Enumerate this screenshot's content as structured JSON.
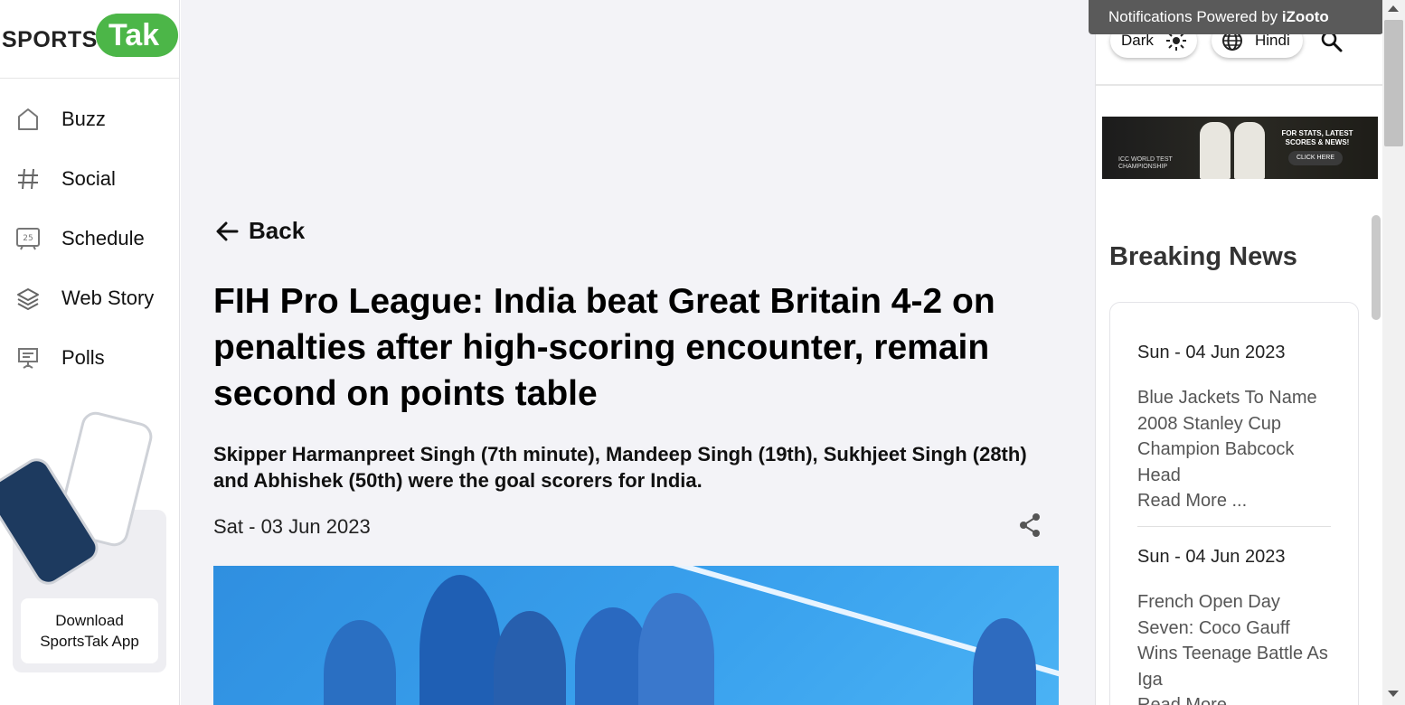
{
  "logo": {
    "sports": "SPORTS",
    "tak": "Tak"
  },
  "nav": {
    "items": [
      {
        "label": "Buzz",
        "icon": "home-icon"
      },
      {
        "label": "Social",
        "icon": "hashtag-icon"
      },
      {
        "label": "Schedule",
        "icon": "calendar-icon"
      },
      {
        "label": "Web Story",
        "icon": "layers-icon"
      },
      {
        "label": "Polls",
        "icon": "poll-board-icon"
      }
    ]
  },
  "promo": {
    "download_label": "Download SportsTak App"
  },
  "article": {
    "back_label": "Back",
    "headline": "FIH Pro League: India beat Great Britain 4-2 on penalties after high-scoring encounter, remain second on points table",
    "summary": "Skipper Harmanpreet Singh (7th minute), Mandeep Singh (19th), Sukhjeet Singh (28th) and Abhishek (50th) were the goal scorers for India.",
    "date": "Sat - 03 Jun 2023"
  },
  "controls": {
    "theme_label": "Dark",
    "language_label": "Hindi"
  },
  "notification": {
    "text": "Notifications Powered by ",
    "brand": "iZooto"
  },
  "banner": {
    "left_text": "ICC WORLD TEST CHAMPIONSHIP",
    "right_text": "FOR STATS, LATEST SCORES & NEWS!",
    "cta": "CLICK HERE"
  },
  "breaking": {
    "title": "Breaking News",
    "items": [
      {
        "date": "Sun - 04 Jun 2023",
        "headline": "Blue Jackets To Name 2008 Stanley Cup Champion Babcock Head",
        "more": "Read More ..."
      },
      {
        "date": "Sun - 04 Jun 2023",
        "headline": "French Open Day Seven: Coco Gauff Wins Teenage Battle As Iga",
        "more": "Read More ..."
      }
    ]
  },
  "colors": {
    "brand_green": "#4cb648",
    "main_bg": "#f3f3f7",
    "hero_blue": "#3aa2ee"
  }
}
